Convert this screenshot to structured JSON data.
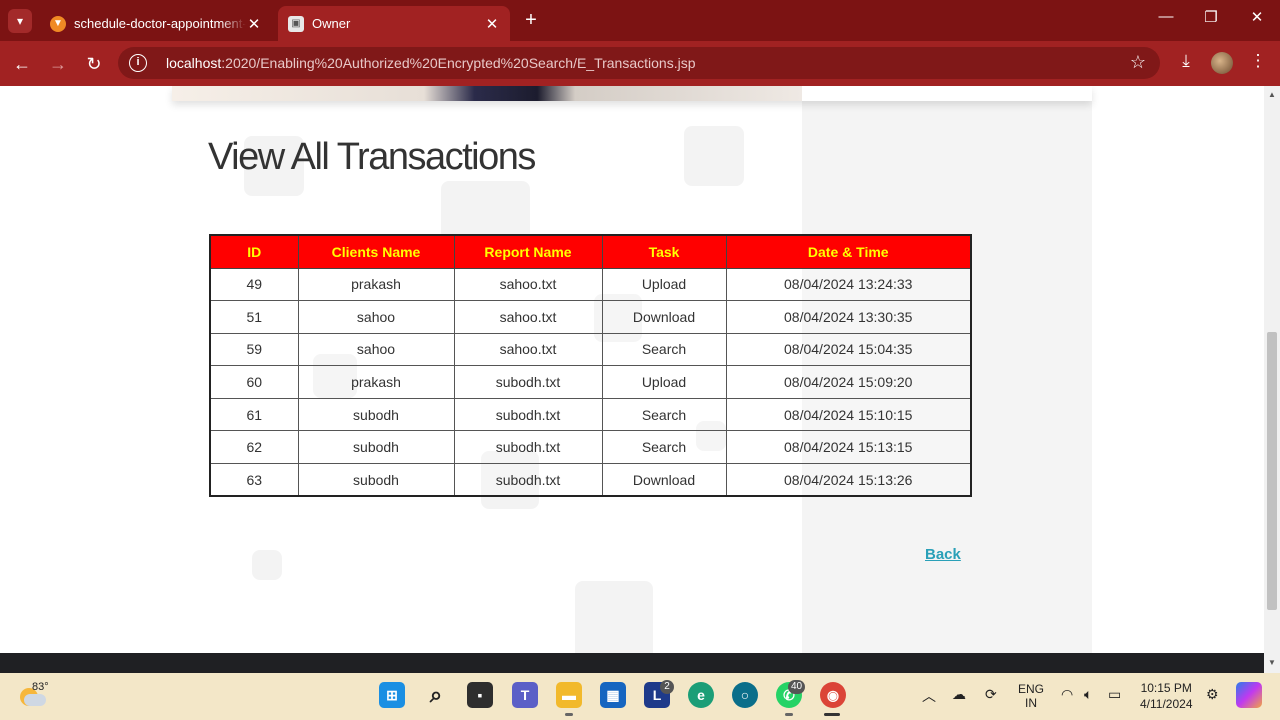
{
  "browser": {
    "tabs": [
      {
        "title": "schedule-doctor-appointment-",
        "active": false
      },
      {
        "title": "Owner",
        "active": true
      }
    ],
    "url_host": "localhost",
    "url_path": ":2020/Enabling%20Authorized%20Encrypted%20Search/E_Transactions.jsp"
  },
  "page": {
    "title": "View All Transactions",
    "table": {
      "headers": [
        "ID",
        "Clients Name",
        "Report Name",
        "Task",
        "Date & Time"
      ],
      "rows": [
        [
          "49",
          "prakash",
          "sahoo.txt",
          "Upload",
          "08/04/2024 13:24:33"
        ],
        [
          "51",
          "sahoo",
          "sahoo.txt",
          "Download",
          "08/04/2024 13:30:35"
        ],
        [
          "59",
          "sahoo",
          "sahoo.txt",
          "Search",
          "08/04/2024 15:04:35"
        ],
        [
          "60",
          "prakash",
          "subodh.txt",
          "Upload",
          "08/04/2024 15:09:20"
        ],
        [
          "61",
          "subodh",
          "subodh.txt",
          "Search",
          "08/04/2024 15:10:15"
        ],
        [
          "62",
          "subodh",
          "subodh.txt",
          "Search",
          "08/04/2024 15:13:15"
        ],
        [
          "63",
          "subodh",
          "subodh.txt",
          "Download",
          "08/04/2024 15:13:26"
        ]
      ]
    },
    "back_label": "Back"
  },
  "taskbar": {
    "temperature": "83°",
    "badges": {
      "l_app": "2",
      "whatsapp": "40"
    },
    "lang_1": "ENG",
    "lang_2": "IN",
    "time": "10:15 PM",
    "date": "4/11/2024"
  },
  "colors": {
    "tab_strip": "#7c1313",
    "toolbar": "#a12222",
    "table_header_bg": "#ff0000",
    "table_header_text": "#ffff00",
    "back_link": "#2aa0b8"
  }
}
